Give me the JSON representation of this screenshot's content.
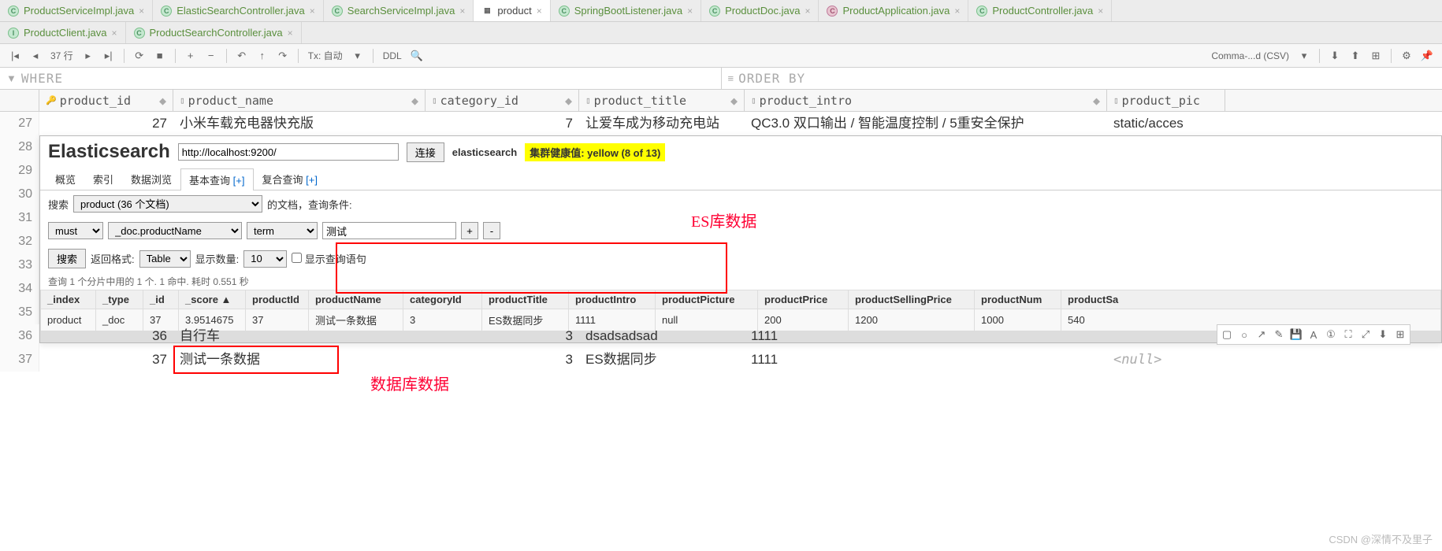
{
  "tabs_row1": [
    {
      "label": "ProductServiceImpl.java",
      "icon": "java"
    },
    {
      "label": "ElasticSearchController.java",
      "icon": "java"
    },
    {
      "label": "SearchServiceImpl.java",
      "icon": "java"
    },
    {
      "label": "product",
      "icon": "db",
      "active": true
    },
    {
      "label": "SpringBootListener.java",
      "icon": "java"
    },
    {
      "label": "ProductDoc.java",
      "icon": "java"
    },
    {
      "label": "ProductApplication.java",
      "icon": "javaG"
    },
    {
      "label": "ProductController.java",
      "icon": "java"
    }
  ],
  "tabs_row2": [
    {
      "label": "ProductClient.java",
      "icon": "java"
    },
    {
      "label": "ProductSearchController.java",
      "icon": "java"
    }
  ],
  "toolbar": {
    "row_label": "37 行",
    "tx_label": "Tx: 自动",
    "ddl_label": "DDL",
    "csv_label": "Comma-...d (CSV)"
  },
  "filter": {
    "where": "WHERE",
    "orderby": "ORDER BY"
  },
  "columns": [
    "product_id",
    "product_name",
    "category_id",
    "product_title",
    "product_intro",
    "product_pic"
  ],
  "rows": [
    {
      "n": "27",
      "id": "27",
      "name": "小米车载充电器快充版",
      "cat": "7",
      "title": "让爱车成为移动充电站",
      "intro": "QC3.0 双口输出 / 智能温度控制 / 5重安全保护",
      "pic": "static/acces"
    },
    {
      "n": "28"
    },
    {
      "n": "29"
    },
    {
      "n": "30"
    },
    {
      "n": "31"
    },
    {
      "n": "32"
    },
    {
      "n": "33"
    },
    {
      "n": "34"
    },
    {
      "n": "35"
    },
    {
      "n": "36",
      "id": "36",
      "name": "自行车",
      "cat": "3",
      "title": "dsadsadsad",
      "intro": "1111",
      "pic": ""
    },
    {
      "n": "37",
      "id": "37",
      "name": "测试一条数据",
      "cat": "3",
      "title": "ES数据同步",
      "intro": "1111",
      "pic": "<null>"
    }
  ],
  "es": {
    "title": "Elasticsearch",
    "url": "http://localhost:9200/",
    "connect_btn": "连接",
    "cluster_name": "elasticsearch",
    "health": "集群健康值: yellow (8 of 13)",
    "tabs": [
      "概览",
      "索引",
      "数据浏览",
      "基本查询 [+]",
      "复合查询 [+]"
    ],
    "active_tab_idx": 3,
    "search_label": "搜索",
    "index_select": "product (36 个文档)",
    "docs_label": "的文档，查询条件:",
    "bool": "must",
    "field": "_doc.productName",
    "op": "term",
    "value": "测试",
    "search_btn": "搜索",
    "return_fmt_label": "返回格式:",
    "return_fmt": "Table",
    "size_label": "显示数量:",
    "size": "10",
    "show_query": "显示查询语句",
    "result_info": "查询 1 个分片中用的 1 个. 1 命中. 耗时 0.551 秒",
    "headers": [
      "_index",
      "_type",
      "_id",
      "_score ▲",
      "productId",
      "productName",
      "categoryId",
      "productTitle",
      "productIntro",
      "productPicture",
      "productPrice",
      "productSellingPrice",
      "productNum",
      "productSa"
    ],
    "row": [
      "product",
      "_doc",
      "37",
      "3.9514675",
      "37",
      "测试一条数据",
      "3",
      "ES数据同步",
      "1111",
      "null",
      "200",
      "1200",
      "1000",
      "540"
    ]
  },
  "annotations": {
    "es_label": "ES库数据",
    "db_label": "数据库数据"
  },
  "watermark": "CSDN @深情不及里子"
}
